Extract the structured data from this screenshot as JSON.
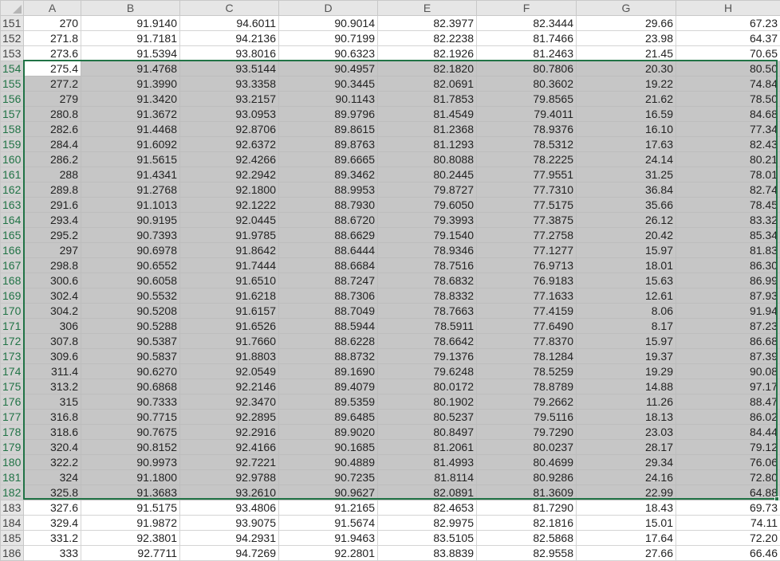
{
  "sheet": {
    "columns": [
      "A",
      "B",
      "C",
      "D",
      "E",
      "F",
      "G",
      "H"
    ],
    "active_cell": "A154",
    "selection": {
      "from_row": "154",
      "to_row": "182",
      "from_col": "A",
      "to_col": "H"
    },
    "colors": {
      "selection_border": "#217346",
      "selection_fill": "#c6c6c6",
      "header_fill": "#e6e6e6"
    },
    "rows": [
      {
        "num": "151",
        "cells": [
          "270",
          "91.9140",
          "94.6011",
          "90.9014",
          "82.3977",
          "82.3444",
          "29.66",
          "67.23"
        ]
      },
      {
        "num": "152",
        "cells": [
          "271.8",
          "91.7181",
          "94.2136",
          "90.7199",
          "82.2238",
          "81.7466",
          "23.98",
          "64.37"
        ]
      },
      {
        "num": "153",
        "cells": [
          "273.6",
          "91.5394",
          "93.8016",
          "90.6323",
          "82.1926",
          "81.2463",
          "21.45",
          "70.65"
        ]
      },
      {
        "num": "154",
        "cells": [
          "275.4",
          "91.4768",
          "93.5144",
          "90.4957",
          "82.1820",
          "80.7806",
          "20.30",
          "80.50"
        ]
      },
      {
        "num": "155",
        "cells": [
          "277.2",
          "91.3990",
          "93.3358",
          "90.3445",
          "82.0691",
          "80.3602",
          "19.22",
          "74.84"
        ]
      },
      {
        "num": "156",
        "cells": [
          "279",
          "91.3420",
          "93.2157",
          "90.1143",
          "81.7853",
          "79.8565",
          "21.62",
          "78.50"
        ]
      },
      {
        "num": "157",
        "cells": [
          "280.8",
          "91.3672",
          "93.0953",
          "89.9796",
          "81.4549",
          "79.4011",
          "16.59",
          "84.68"
        ]
      },
      {
        "num": "158",
        "cells": [
          "282.6",
          "91.4468",
          "92.8706",
          "89.8615",
          "81.2368",
          "78.9376",
          "16.10",
          "77.34"
        ]
      },
      {
        "num": "159",
        "cells": [
          "284.4",
          "91.6092",
          "92.6372",
          "89.8763",
          "81.1293",
          "78.5312",
          "17.63",
          "82.43"
        ]
      },
      {
        "num": "160",
        "cells": [
          "286.2",
          "91.5615",
          "92.4266",
          "89.6665",
          "80.8088",
          "78.2225",
          "24.14",
          "80.21"
        ]
      },
      {
        "num": "161",
        "cells": [
          "288",
          "91.4341",
          "92.2942",
          "89.3462",
          "80.2445",
          "77.9551",
          "31.25",
          "78.01"
        ]
      },
      {
        "num": "162",
        "cells": [
          "289.8",
          "91.2768",
          "92.1800",
          "88.9953",
          "79.8727",
          "77.7310",
          "36.84",
          "82.74"
        ]
      },
      {
        "num": "163",
        "cells": [
          "291.6",
          "91.1013",
          "92.1222",
          "88.7930",
          "79.6050",
          "77.5175",
          "35.66",
          "78.45"
        ]
      },
      {
        "num": "164",
        "cells": [
          "293.4",
          "90.9195",
          "92.0445",
          "88.6720",
          "79.3993",
          "77.3875",
          "26.12",
          "83.32"
        ]
      },
      {
        "num": "165",
        "cells": [
          "295.2",
          "90.7393",
          "91.9785",
          "88.6629",
          "79.1540",
          "77.2758",
          "20.42",
          "85.34"
        ]
      },
      {
        "num": "166",
        "cells": [
          "297",
          "90.6978",
          "91.8642",
          "88.6444",
          "78.9346",
          "77.1277",
          "15.97",
          "81.83"
        ]
      },
      {
        "num": "167",
        "cells": [
          "298.8",
          "90.6552",
          "91.7444",
          "88.6684",
          "78.7516",
          "76.9713",
          "18.01",
          "86.30"
        ]
      },
      {
        "num": "168",
        "cells": [
          "300.6",
          "90.6058",
          "91.6510",
          "88.7247",
          "78.6832",
          "76.9183",
          "15.63",
          "86.99"
        ]
      },
      {
        "num": "169",
        "cells": [
          "302.4",
          "90.5532",
          "91.6218",
          "88.7306",
          "78.8332",
          "77.1633",
          "12.61",
          "87.93"
        ]
      },
      {
        "num": "170",
        "cells": [
          "304.2",
          "90.5208",
          "91.6157",
          "88.7049",
          "78.7663",
          "77.4159",
          "8.06",
          "91.94"
        ]
      },
      {
        "num": "171",
        "cells": [
          "306",
          "90.5288",
          "91.6526",
          "88.5944",
          "78.5911",
          "77.6490",
          "8.17",
          "87.23"
        ]
      },
      {
        "num": "172",
        "cells": [
          "307.8",
          "90.5387",
          "91.7660",
          "88.6228",
          "78.6642",
          "77.8370",
          "15.97",
          "86.68"
        ]
      },
      {
        "num": "173",
        "cells": [
          "309.6",
          "90.5837",
          "91.8803",
          "88.8732",
          "79.1376",
          "78.1284",
          "19.37",
          "87.39"
        ]
      },
      {
        "num": "174",
        "cells": [
          "311.4",
          "90.6270",
          "92.0549",
          "89.1690",
          "79.6248",
          "78.5259",
          "19.29",
          "90.08"
        ]
      },
      {
        "num": "175",
        "cells": [
          "313.2",
          "90.6868",
          "92.2146",
          "89.4079",
          "80.0172",
          "78.8789",
          "14.88",
          "97.17"
        ]
      },
      {
        "num": "176",
        "cells": [
          "315",
          "90.7333",
          "92.3470",
          "89.5359",
          "80.1902",
          "79.2662",
          "11.26",
          "88.47"
        ]
      },
      {
        "num": "177",
        "cells": [
          "316.8",
          "90.7715",
          "92.2895",
          "89.6485",
          "80.5237",
          "79.5116",
          "18.13",
          "86.02"
        ]
      },
      {
        "num": "178",
        "cells": [
          "318.6",
          "90.7675",
          "92.2916",
          "89.9020",
          "80.8497",
          "79.7290",
          "23.03",
          "84.44"
        ]
      },
      {
        "num": "179",
        "cells": [
          "320.4",
          "90.8152",
          "92.4166",
          "90.1685",
          "81.2061",
          "80.0237",
          "28.17",
          "79.12"
        ]
      },
      {
        "num": "180",
        "cells": [
          "322.2",
          "90.9973",
          "92.7221",
          "90.4889",
          "81.4993",
          "80.4699",
          "29.34",
          "76.06"
        ]
      },
      {
        "num": "181",
        "cells": [
          "324",
          "91.1800",
          "92.9788",
          "90.7235",
          "81.8114",
          "80.9286",
          "24.16",
          "72.80"
        ]
      },
      {
        "num": "182",
        "cells": [
          "325.8",
          "91.3683",
          "93.2610",
          "90.9627",
          "82.0891",
          "81.3609",
          "22.99",
          "64.88"
        ]
      },
      {
        "num": "183",
        "cells": [
          "327.6",
          "91.5175",
          "93.4806",
          "91.2165",
          "82.4653",
          "81.7290",
          "18.43",
          "69.73"
        ]
      },
      {
        "num": "184",
        "cells": [
          "329.4",
          "91.9872",
          "93.9075",
          "91.5674",
          "82.9975",
          "82.1816",
          "15.01",
          "74.11"
        ]
      },
      {
        "num": "185",
        "cells": [
          "331.2",
          "92.3801",
          "94.2931",
          "91.9463",
          "83.5105",
          "82.5868",
          "17.64",
          "72.20"
        ]
      },
      {
        "num": "186",
        "cells": [
          "333",
          "92.7711",
          "94.7269",
          "92.2801",
          "83.8839",
          "82.9558",
          "27.66",
          "66.46"
        ]
      }
    ]
  }
}
